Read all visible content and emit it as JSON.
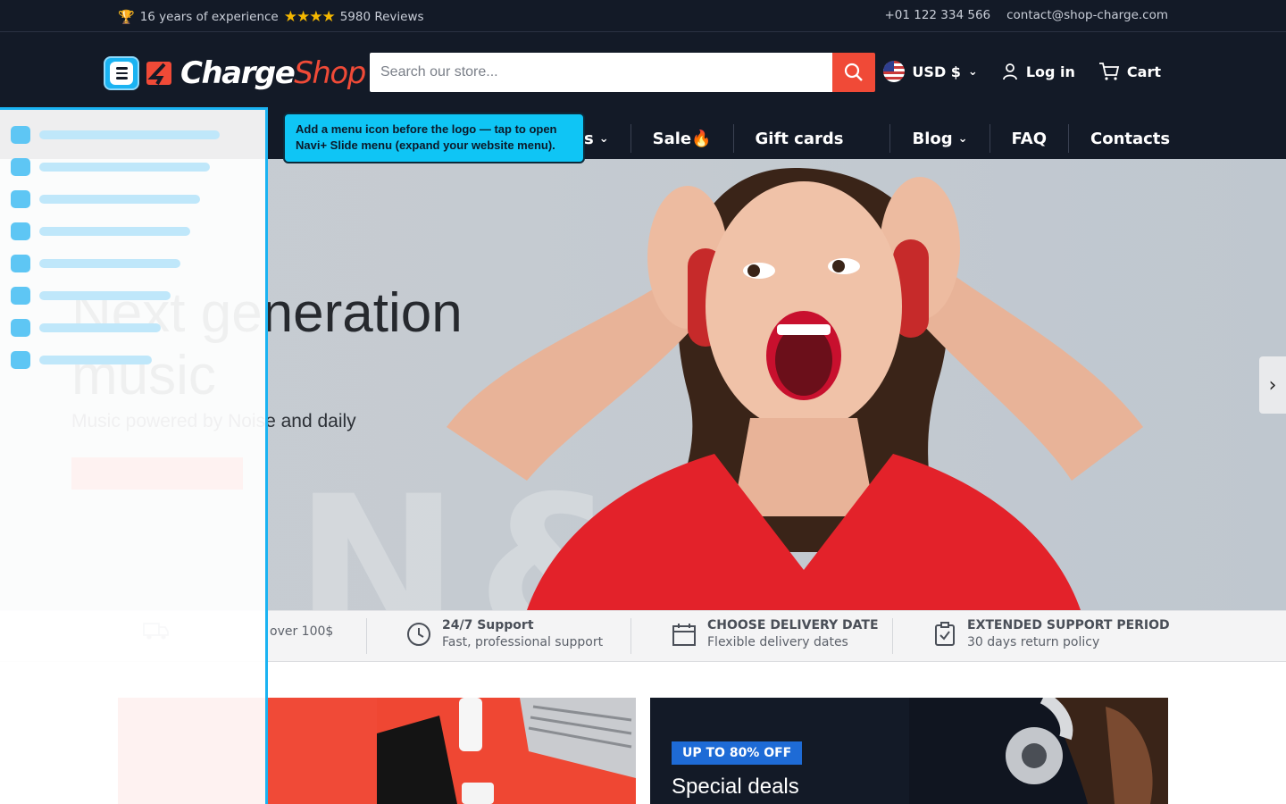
{
  "topbar": {
    "experience": "16 years of experience",
    "stars": "★★★★",
    "reviews": "5980 Reviews",
    "phone": "+01 122 334 566",
    "email": "contact@shop-charge.com"
  },
  "header": {
    "logo_charge": "Charge",
    "logo_shop": "Shop",
    "search_placeholder": "Search our store...",
    "currency": "USD $",
    "login": "Log in",
    "cart": "Cart"
  },
  "nav": {
    "items": [
      {
        "label": "s",
        "chevron": true
      },
      {
        "label": "Sale🔥",
        "chevron": false
      },
      {
        "label": "Gift cards",
        "chevron": false
      },
      {
        "label": "Blog",
        "chevron": true
      },
      {
        "label": "FAQ",
        "chevron": false
      },
      {
        "label": "Contacts",
        "chevron": false
      }
    ]
  },
  "hero": {
    "title_line1": "Next generation",
    "title_line2": "music",
    "subtitle": "Music powered by Noise and daily"
  },
  "features": [
    {
      "title": "",
      "subtitle": "over 100$",
      "icon": "truck-icon"
    },
    {
      "title": "24/7 Support",
      "subtitle": "Fast, professional support",
      "icon": "clock-icon"
    },
    {
      "title": "CHOOSE DELIVERY DATE",
      "subtitle": "Flexible delivery dates",
      "icon": "calendar-icon"
    },
    {
      "title": "EXTENDED SUPPORT PERIOD",
      "subtitle": "30 days return policy",
      "icon": "clipboard-check-icon"
    }
  ],
  "promo": {
    "right_badge": "UP TO 80% OFF",
    "right_title": "Special deals"
  },
  "tooltip": {
    "text": "Add a menu icon before the logo — tap to open Navi+ Slide menu (expand your website menu)."
  },
  "colors": {
    "accent": "#f04a37",
    "dark": "#131a27",
    "menu_blue": "#1ab3f2"
  }
}
